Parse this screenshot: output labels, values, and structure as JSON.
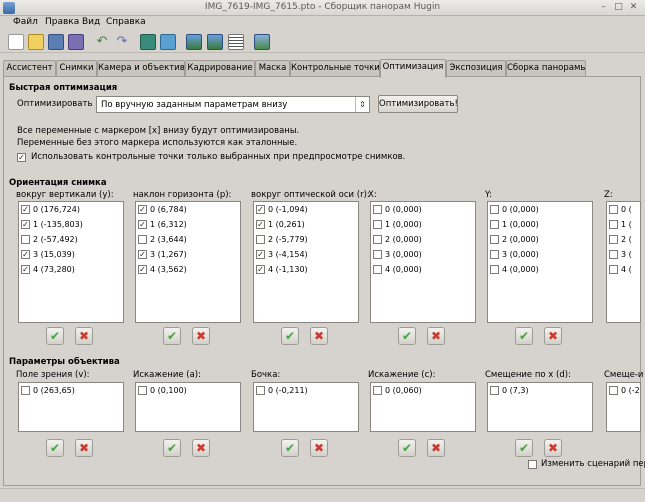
{
  "window": {
    "title": "IMG_7619-IMG_7615.pto - Сборщик панорам Hugin"
  },
  "menu": [
    "Файл",
    "Правка",
    "Вид",
    "Справка"
  ],
  "toolbar_icons": [
    "new-icon",
    "open-icon",
    "save-icon",
    "save-as-icon",
    "undo-icon",
    "redo-icon",
    "add-images-icon",
    "add-series-icon",
    "align-icon",
    "control-points-icon",
    "table-icon",
    "preview-icon"
  ],
  "tabs": [
    "Ассистент",
    "Снимки",
    "Камера и объектив",
    "Кадрирование",
    "Маска",
    "Контрольные точки",
    "Оптимизация",
    "Экспозиция",
    "Сборка панорамы"
  ],
  "active_tab": "Оптимизация",
  "quick": {
    "section": "Быстрая оптимизация",
    "label": "Оптимизировать",
    "combo_value": "По вручную заданным параметрам внизу",
    "button": "Оптимизировать!",
    "note1": "Все переменные с маркером [x] внизу будут оптимизированы.",
    "note2": "Переменные без этого маркера используются как эталонные.",
    "use_cp_label": "Использовать контрольные точки только выбранных при предпросмотре снимков.",
    "use_cp_checked": true
  },
  "orientation": {
    "section": "Ориентация снимка",
    "columns": [
      {
        "header": "вокруг вертикали (y):",
        "items": [
          {
            "label": "0 (176,724)",
            "checked": true
          },
          {
            "label": "1 (-135,803)",
            "checked": true
          },
          {
            "label": "2 (-57,492)",
            "checked": false
          },
          {
            "label": "3 (15,039)",
            "checked": true
          },
          {
            "label": "4 (73,280)",
            "checked": true
          }
        ]
      },
      {
        "header": "наклон горизонта (p):",
        "items": [
          {
            "label": "0 (6,784)",
            "checked": true
          },
          {
            "label": "1 (6,312)",
            "checked": true
          },
          {
            "label": "2 (3,644)",
            "checked": false
          },
          {
            "label": "3 (1,267)",
            "checked": true
          },
          {
            "label": "4 (3,562)",
            "checked": true
          }
        ]
      },
      {
        "header": "вокруг оптической оси (r):",
        "items": [
          {
            "label": "0 (-1,094)",
            "checked": true
          },
          {
            "label": "1 (0,261)",
            "checked": true
          },
          {
            "label": "2 (-5,779)",
            "checked": false
          },
          {
            "label": "3 (-4,154)",
            "checked": true
          },
          {
            "label": "4 (-1,130)",
            "checked": true
          }
        ]
      },
      {
        "header": "X:",
        "items": [
          {
            "label": "0 (0,000)",
            "checked": false
          },
          {
            "label": "1 (0,000)",
            "checked": false
          },
          {
            "label": "2 (0,000)",
            "checked": false
          },
          {
            "label": "3 (0,000)",
            "checked": false
          },
          {
            "label": "4 (0,000)",
            "checked": false
          }
        ]
      },
      {
        "header": "Y:",
        "items": [
          {
            "label": "0 (0,000)",
            "checked": false
          },
          {
            "label": "1 (0,000)",
            "checked": false
          },
          {
            "label": "2 (0,000)",
            "checked": false
          },
          {
            "label": "3 (0,000)",
            "checked": false
          },
          {
            "label": "4 (0,000)",
            "checked": false
          }
        ]
      },
      {
        "header": "Z:",
        "items": [
          {
            "label": "0 (",
            "checked": false
          },
          {
            "label": "1 (",
            "checked": false
          },
          {
            "label": "2 (",
            "checked": false
          },
          {
            "label": "3 (",
            "checked": false
          },
          {
            "label": "4 (",
            "checked": false
          }
        ]
      }
    ]
  },
  "lens": {
    "section": "Параметры объектива",
    "columns": [
      {
        "header": "Поле зрения (v):",
        "items": [
          {
            "label": "0 (263,65)",
            "checked": false
          }
        ]
      },
      {
        "header": "Искажение (a):",
        "items": [
          {
            "label": "0 (0,100)",
            "checked": false
          }
        ]
      },
      {
        "header": "Бочка:",
        "items": [
          {
            "label": "0 (-0,211)",
            "checked": false
          }
        ]
      },
      {
        "header": "Искажение (c):",
        "items": [
          {
            "label": "0 (0,060)",
            "checked": false
          }
        ]
      },
      {
        "header": "Смещение по x (d):",
        "items": [
          {
            "label": "0 (7,3)",
            "checked": false
          }
        ]
      },
      {
        "header": "Смеще-и",
        "items": [
          {
            "label": "0 (-2",
            "checked": false
          }
        ]
      }
    ]
  },
  "edit_script_label": "Изменить сценарий пер",
  "edit_script_checked": false,
  "check_glyph": "✓",
  "ok_glyph": "✔",
  "cancel_glyph": "✖"
}
